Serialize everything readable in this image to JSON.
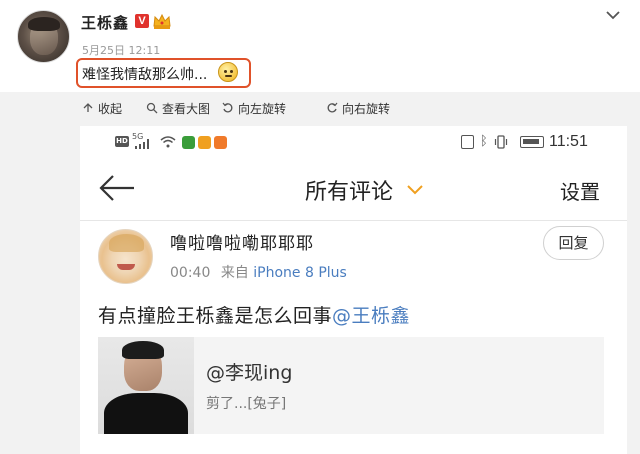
{
  "post": {
    "username": "王栎鑫",
    "verified_badge": "V",
    "time": "5月25日 12:11",
    "text": "难怪我情敌那么帅...",
    "highlight_color": "#e0522a"
  },
  "toolbar": {
    "collapse": "收起",
    "view_large": "查看大图",
    "rotate_left": "向左旋转",
    "rotate_right": "向右旋转"
  },
  "phone": {
    "status": {
      "network": "5G",
      "hd": "HD",
      "time": "11:51"
    },
    "nav": {
      "title": "所有评论",
      "settings": "设置"
    },
    "comment": {
      "name": "噜啦噜啦嘞耶耶耶",
      "time": "00:40",
      "from": "来自",
      "device": "iPhone 8 Plus",
      "reply": "回复",
      "text_prefix": "有点撞脸王栎鑫是怎么回事",
      "mention": "@王栎鑫"
    },
    "card": {
      "handle": "@李现ing",
      "subtitle": "剪了...[兔子]"
    }
  },
  "colors": {
    "accent": "#4a7dbf",
    "chevron": "#f0a020"
  }
}
